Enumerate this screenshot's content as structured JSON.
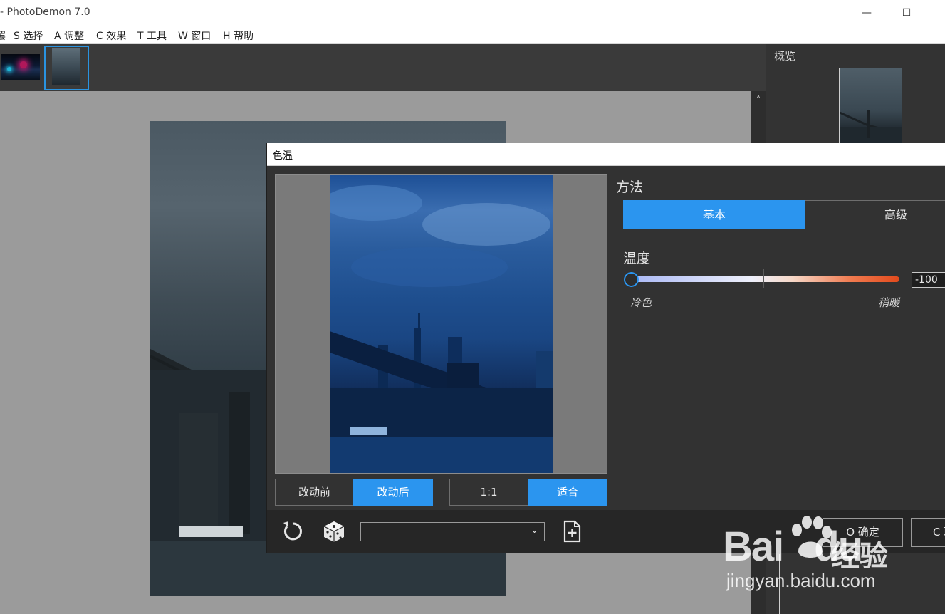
{
  "window": {
    "title": "- PhotoDemon 7.0",
    "minimize_glyph": "—",
    "maximize_glyph": "☐"
  },
  "menubar": {
    "items": [
      "罢",
      "S 选择",
      "A 调整",
      "C 效果",
      "T 工具",
      "W 窗口",
      "H 帮助"
    ]
  },
  "scrollbar": {
    "up_glyph": "˄"
  },
  "overview": {
    "label": "概览"
  },
  "dialog": {
    "title": "色温",
    "preview": {
      "before_label": "改动前",
      "after_label": "改动后",
      "active_compare": "after",
      "zoom_1_1_label": "1:1",
      "zoom_fit_label": "适合",
      "active_zoom": "fit"
    },
    "method": {
      "label": "方法",
      "basic_label": "基本",
      "advanced_label": "高级",
      "active": "basic"
    },
    "temperature": {
      "label": "温度",
      "value": "-100",
      "min_hint": "冷色",
      "max_hint": "稍暖",
      "min": -100,
      "max": 100
    },
    "footer": {
      "reset_icon": "rotate-reset-icon",
      "randomize_icon": "dice-icon",
      "preset_value": "",
      "save_preset_icon": "add-file-icon",
      "ok_label": "O 确定",
      "cancel_label": "C 取消"
    }
  },
  "watermark": {
    "brand": "Bai",
    "brand_tail": "du",
    "brand_cn": "经验",
    "url": "jingyan.baidu.com"
  },
  "colors": {
    "accent": "#2b95ef",
    "dialog_bg": "#323232",
    "footer_bg": "#262626",
    "canvas_bg": "#9b9b9b"
  }
}
